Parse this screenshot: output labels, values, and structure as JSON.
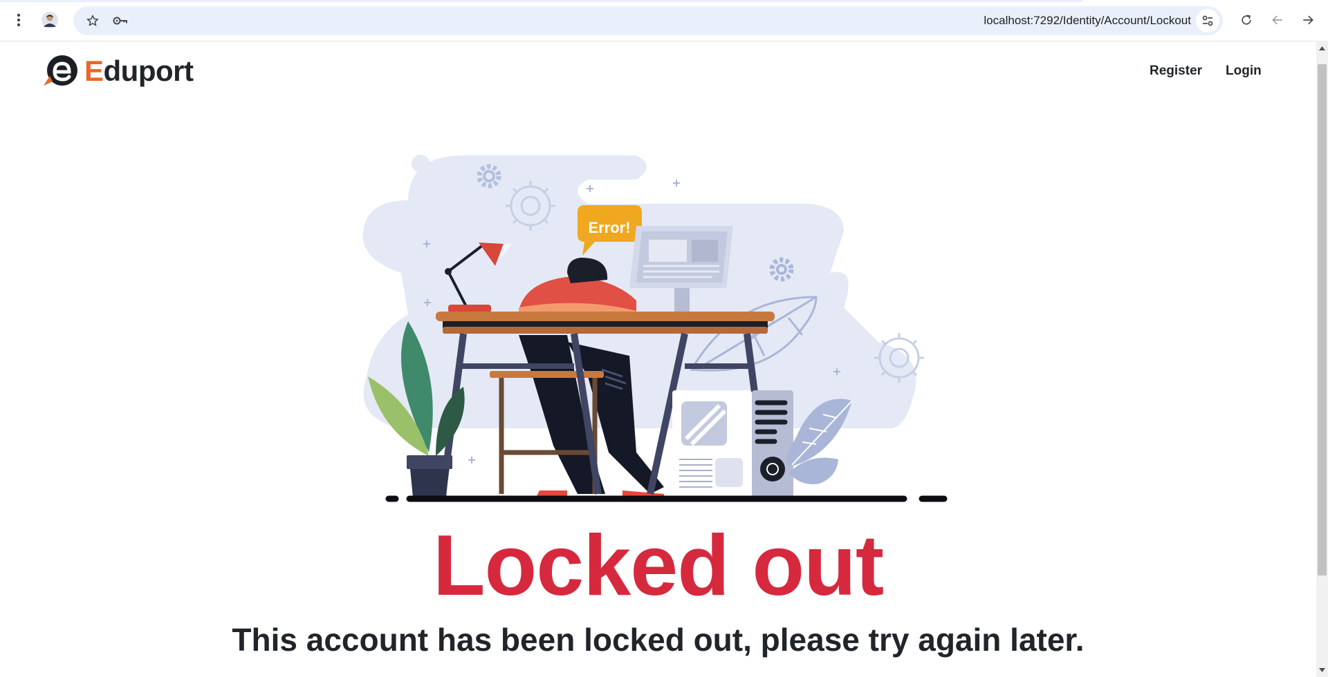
{
  "browser": {
    "url": "localhost:7292/Identity/Account/Lockout",
    "icons": {
      "menu": "more-vert-icon",
      "profile": "profile-avatar-icon",
      "bookmark": "star-icon",
      "password": "key-icon",
      "site_settings": "tune-icon",
      "reload": "reload-icon",
      "back": "back-arrow-icon",
      "forward": "forward-arrow-icon"
    }
  },
  "navbar": {
    "brand_first_letter": "E",
    "brand_rest": "duport",
    "links": [
      {
        "label": "Register"
      },
      {
        "label": "Login"
      }
    ]
  },
  "illustration": {
    "bubble_text": "Error!"
  },
  "main": {
    "title": "Locked out",
    "message": "This account has been locked out, please try again later."
  },
  "colors": {
    "title": "#d6293e",
    "brand_accent": "#e8672a",
    "text_dark": "#212529",
    "bubble": "#f0a820",
    "blob": "#e4e9f5"
  }
}
